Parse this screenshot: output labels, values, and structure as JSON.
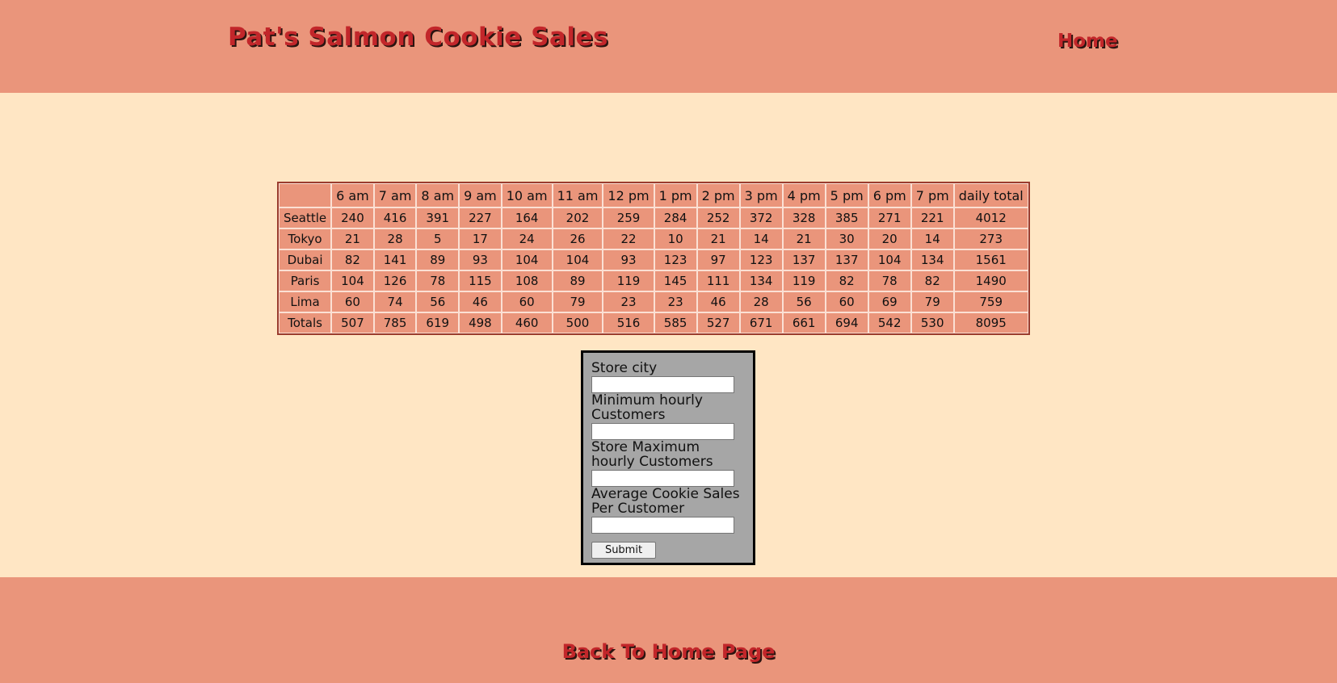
{
  "header": {
    "title": "Pat's Salmon Cookie Sales",
    "nav_home": "Home"
  },
  "sales_table": {
    "headers": [
      "",
      "6 am",
      "7 am",
      "8 am",
      "9 am",
      "10 am",
      "11 am",
      "12 pm",
      "1 pm",
      "2 pm",
      "3 pm",
      "4 pm",
      "5 pm",
      "6 pm",
      "7 pm",
      "daily total"
    ],
    "rows": [
      [
        "Seattle",
        "240",
        "416",
        "391",
        "227",
        "164",
        "202",
        "259",
        "284",
        "252",
        "372",
        "328",
        "385",
        "271",
        "221",
        "4012"
      ],
      [
        "Tokyo",
        "21",
        "28",
        "5",
        "17",
        "24",
        "26",
        "22",
        "10",
        "21",
        "14",
        "21",
        "30",
        "20",
        "14",
        "273"
      ],
      [
        "Dubai",
        "82",
        "141",
        "89",
        "93",
        "104",
        "104",
        "93",
        "123",
        "97",
        "123",
        "137",
        "137",
        "104",
        "134",
        "1561"
      ],
      [
        "Paris",
        "104",
        "126",
        "78",
        "115",
        "108",
        "89",
        "119",
        "145",
        "111",
        "134",
        "119",
        "82",
        "78",
        "82",
        "1490"
      ],
      [
        "Lima",
        "60",
        "74",
        "56",
        "46",
        "60",
        "79",
        "23",
        "23",
        "46",
        "28",
        "56",
        "60",
        "69",
        "79",
        "759"
      ],
      [
        "Totals",
        "507",
        "785",
        "619",
        "498",
        "460",
        "500",
        "516",
        "585",
        "527",
        "671",
        "661",
        "694",
        "542",
        "530",
        "8095"
      ]
    ]
  },
  "form": {
    "fields": [
      {
        "label": "Store city",
        "value": "",
        "name": "store-city-input"
      },
      {
        "label": "Minimum hourly Customers",
        "value": "",
        "name": "min-hourly-customers-input"
      },
      {
        "label": "Store Maximum hourly Customers",
        "value": "",
        "name": "max-hourly-customers-input"
      },
      {
        "label": "Average Cookie Sales Per Customer",
        "value": "",
        "name": "avg-cookie-sales-input"
      }
    ],
    "submit_label": "Submit"
  },
  "footer": {
    "back_link": "Back To Home Page"
  },
  "colors": {
    "header_bg": "#ea957b",
    "page_bg": "#ffe6c4",
    "title_red": "#c2262a",
    "form_bg": "#a6a6a6"
  }
}
